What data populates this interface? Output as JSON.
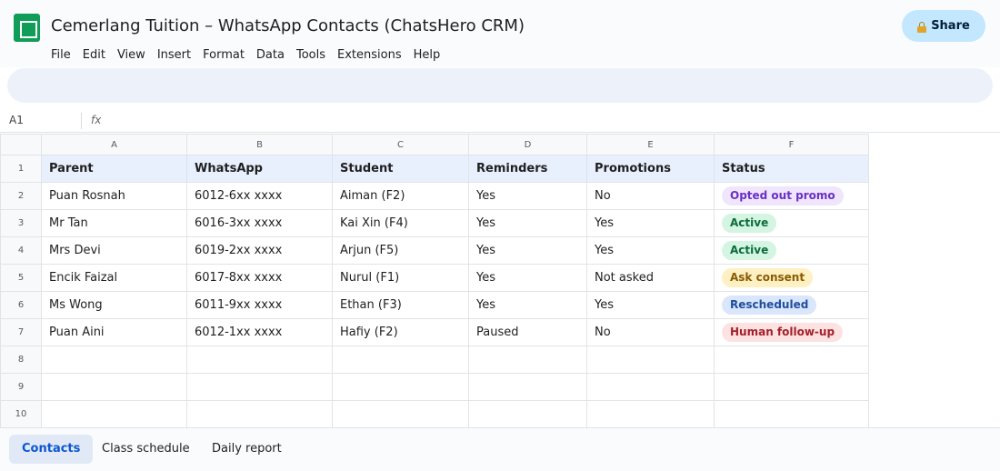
{
  "document": {
    "title": "Cemerlang Tuition – WhatsApp Contacts (ChatsHero CRM)",
    "share_label": "Share"
  },
  "menu": [
    "File",
    "Edit",
    "View",
    "Insert",
    "Format",
    "Data",
    "Tools",
    "Extensions",
    "Help"
  ],
  "formula_bar": {
    "cell_ref": "A1",
    "fx_label": "fx"
  },
  "columns": [
    "A",
    "B",
    "C",
    "D",
    "E",
    "F"
  ],
  "row_numbers": [
    "1",
    "2",
    "3",
    "4",
    "5",
    "6",
    "7",
    "8",
    "9",
    "10"
  ],
  "header_row": [
    "Parent",
    "WhatsApp",
    "Student",
    "Reminders",
    "Promotions",
    "Status"
  ],
  "rows": [
    {
      "parent": "Puan Rosnah",
      "whatsapp": "6012-6xx xxxx",
      "student": "Aiman (F2)",
      "reminders": "Yes",
      "promotions": "No",
      "status": "Opted out promo",
      "status_color": "#6a2fc4"
    },
    {
      "parent": "Mr Tan",
      "whatsapp": "6016-3xx xxxx",
      "student": "Kai Xin (F4)",
      "reminders": "Yes",
      "promotions": "Yes",
      "status": "Active",
      "status_color": "#0c6b3c"
    },
    {
      "parent": "Mrs Devi",
      "whatsapp": "6019-2xx xxxx",
      "student": "Arjun (F5)",
      "reminders": "Yes",
      "promotions": "Yes",
      "status": "Active",
      "status_color": "#0c6b3c"
    },
    {
      "parent": "Encik Faizal",
      "whatsapp": "6017-8xx xxxx",
      "student": "Nurul (F1)",
      "reminders": "Yes",
      "promotions": "Not asked",
      "status": "Ask consent",
      "status_color": "#8a5a00"
    },
    {
      "parent": "Ms Wong",
      "whatsapp": "6011-9xx xxxx",
      "student": "Ethan (F3)",
      "reminders": "Yes",
      "promotions": "Yes",
      "status": "Rescheduled",
      "status_color": "#1f4f9a"
    },
    {
      "parent": "Puan Aini",
      "whatsapp": "6012-1xx xxxx",
      "student": "Hafiy (F2)",
      "reminders": "Paused",
      "promotions": "No",
      "status": "Human follow-up",
      "status_color": "#a3202a"
    }
  ],
  "sheet_tabs": [
    "Contacts",
    "Class schedule",
    "Daily report"
  ],
  "active_tab": "Contacts",
  "colors": {
    "accent": "#0b57d0",
    "share_button": "#c2e7ff",
    "header_row_bg": "#e8f0fe",
    "logo": "#0f9d58"
  },
  "icons": {
    "logo": "sheets-logo-icon",
    "share": "lock-icon"
  }
}
